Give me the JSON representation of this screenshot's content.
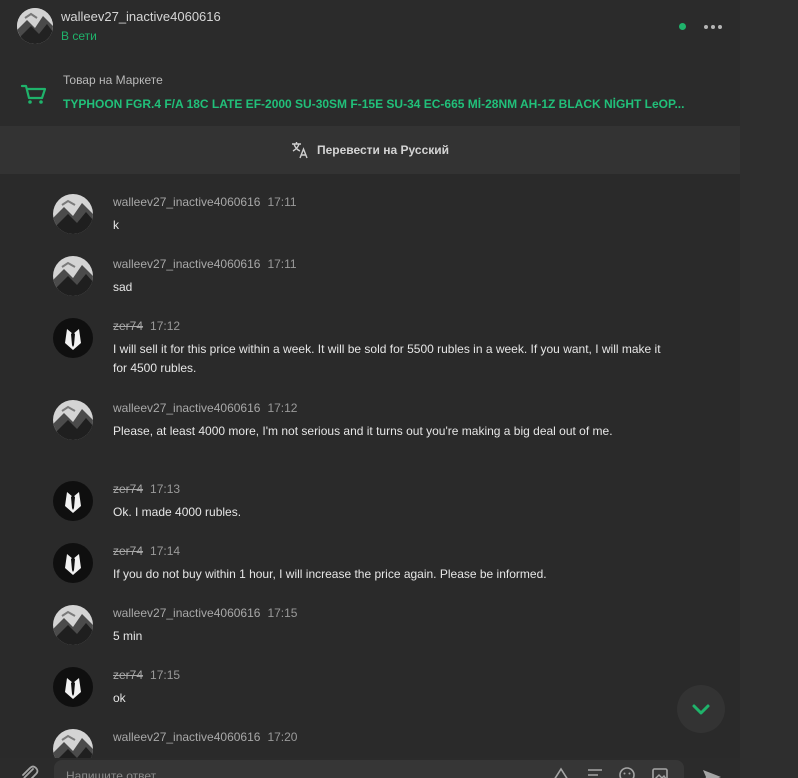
{
  "header": {
    "username": "walleev27_inactive4060616",
    "status": "В сети"
  },
  "market": {
    "label": "Товар на Маркете",
    "title": "TYPHOON FGR.4 F/A 18C LATE EF-2000 SU-30SM F-15E SU-34 EC-665 Mİ-28NM AH-1Z BLACK NİGHT LeOP..."
  },
  "translate": {
    "label": "Перевести на Русский"
  },
  "messages": [
    {
      "author": "walleev27_inactive4060616",
      "time": "17:11",
      "text": "k",
      "avatar": "grey",
      "strike": false
    },
    {
      "author": "walleev27_inactive4060616",
      "time": "17:11",
      "text": "sad",
      "avatar": "grey",
      "strike": false
    },
    {
      "author": "zer74",
      "time": "17:12",
      "text": "I will sell it for this price within a week. It will be sold for 5500 rubles in a week. If you want, I will make it for 4500 rubles.",
      "avatar": "suit",
      "strike": true
    },
    {
      "author": "walleev27_inactive4060616",
      "time": "17:12",
      "text": "Please, at least 4000 more, I'm not serious and it turns out you're making a big deal out of me.",
      "avatar": "grey",
      "strike": false
    },
    {
      "author": "zer74",
      "time": "17:13",
      "text": "Ok. I made 4000 rubles.",
      "avatar": "suit",
      "strike": true
    },
    {
      "author": "zer74",
      "time": "17:14",
      "text": "If you do not buy within 1 hour, I will increase the price again. Please be informed.",
      "avatar": "suit",
      "strike": true
    },
    {
      "author": "walleev27_inactive4060616",
      "time": "17:15",
      "text": "5 min",
      "avatar": "grey",
      "strike": false
    },
    {
      "author": "zer74",
      "time": "17:15",
      "text": "ok",
      "avatar": "suit",
      "strike": true
    },
    {
      "author": "walleev27_inactive4060616",
      "time": "17:20",
      "text": "",
      "avatar": "grey",
      "strike": false
    }
  ],
  "composer": {
    "placeholder": "Напишите ответ..."
  },
  "colors": {
    "accent": "#1fb36b",
    "background": "#2a2a2a",
    "text": "#e6e6e6"
  },
  "icons": {
    "more": "more-horizontal-icon",
    "cart": "cart-icon",
    "translate": "translate-icon",
    "scroll": "chevron-down-icon",
    "attach": "paperclip-icon",
    "send": "send-icon"
  }
}
